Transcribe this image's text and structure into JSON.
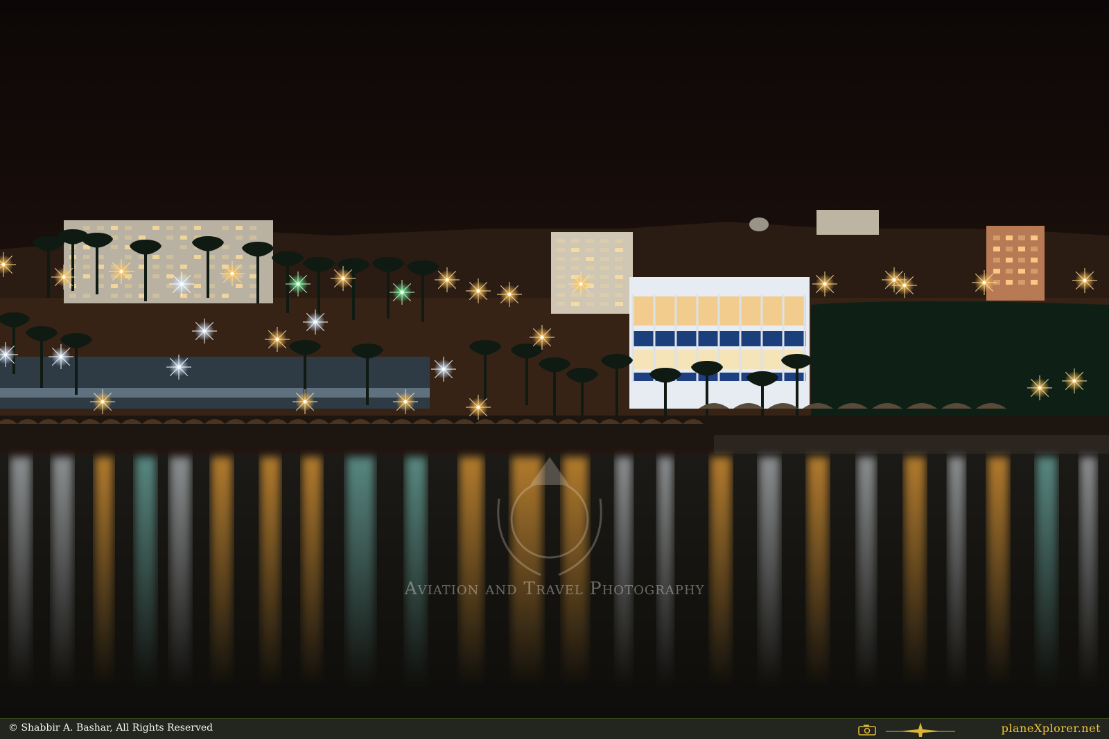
{
  "photo": {
    "description_alt": "",
    "palette": {
      "sky": "#1a0f0d",
      "hill": "#2a1c14",
      "water_warm": "#c9862a",
      "water_cool": "#3a7a7a",
      "light_warm": "#ffc45a",
      "light_cool": "#e8f4ff",
      "accent_red": "#b0202a"
    }
  },
  "watermark": {
    "text": "Aviation and Travel Photography"
  },
  "footer": {
    "copyright": "© Shabbir A. Bashar, All Rights Reserved",
    "brand": "planeXplorer.net",
    "icons": [
      "camera-icon",
      "airplane-icon"
    ],
    "background_color": "#22261f",
    "brand_color": "#f3c53b"
  }
}
